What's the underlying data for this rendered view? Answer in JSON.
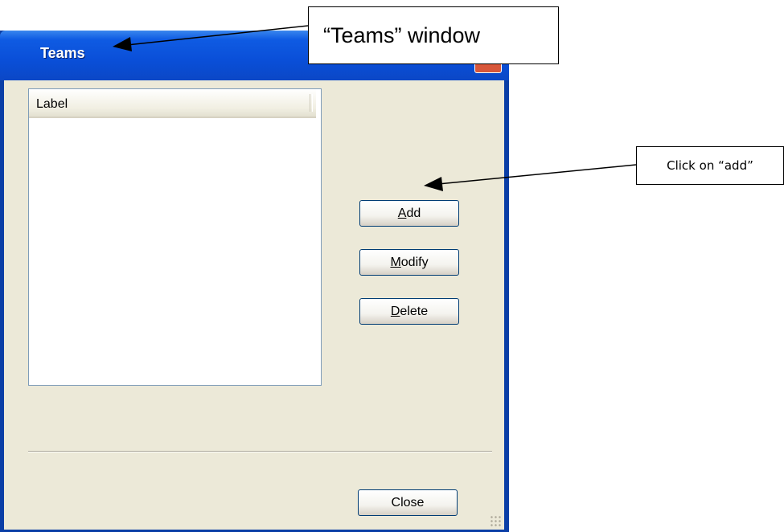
{
  "window": {
    "title": "Teams"
  },
  "list": {
    "column_header": "Label"
  },
  "buttons": {
    "add": {
      "key": "A",
      "rest": "dd"
    },
    "modify": {
      "key": "M",
      "rest": "odify"
    },
    "delete": {
      "key": "D",
      "rest": "elete"
    },
    "close": "Close"
  },
  "annotations": {
    "window_label": "“Teams” window",
    "add_label": "Click on “add”"
  }
}
